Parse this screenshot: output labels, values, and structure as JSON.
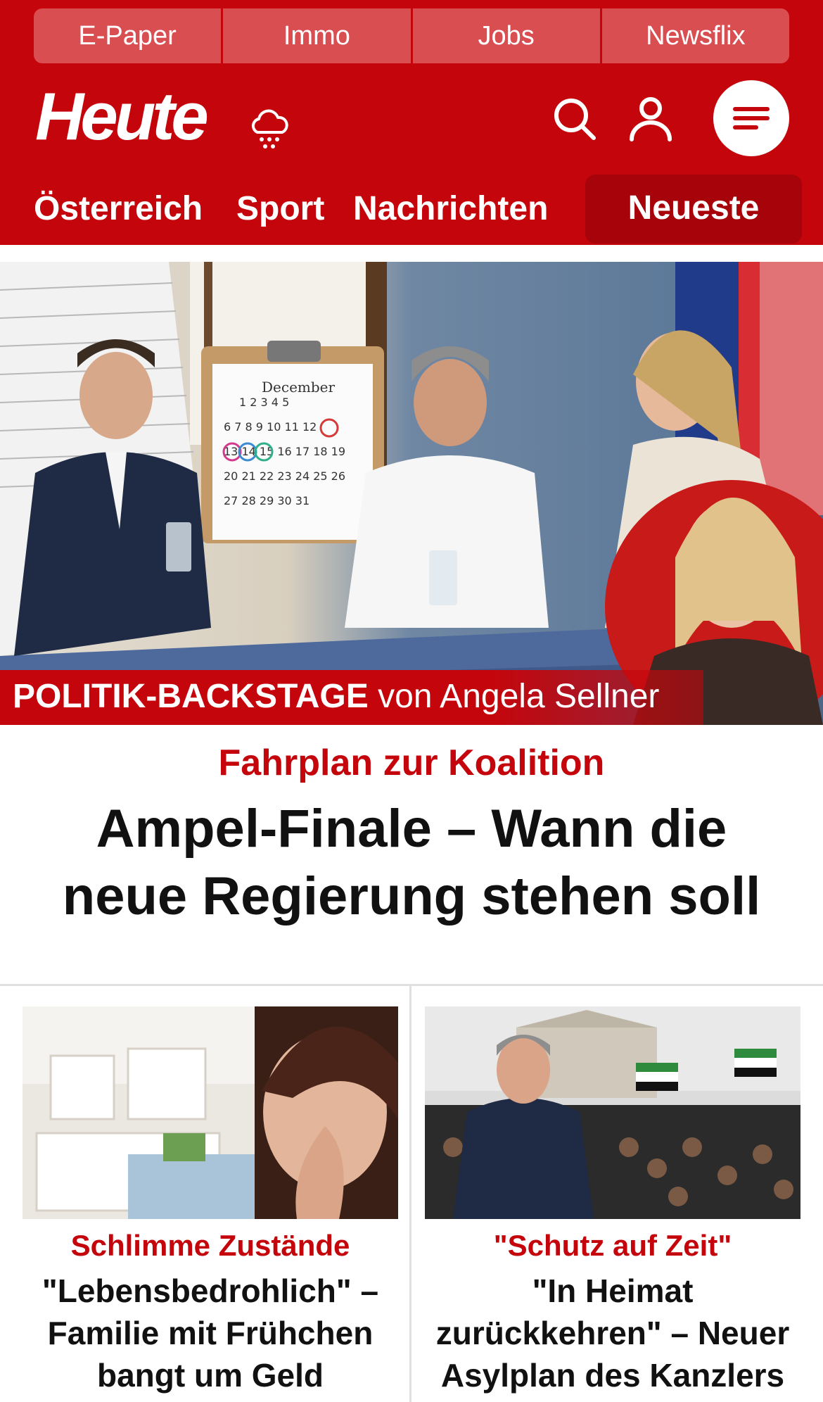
{
  "topnav": [
    "E-Paper",
    "Immo",
    "Jobs",
    "Newsflix"
  ],
  "brand": {
    "logo": "Heute",
    "weather_icon": "cloud-rain-icon"
  },
  "icons": {
    "search": "search-icon",
    "account": "user-icon",
    "menu": "menu-icon"
  },
  "sections": [
    "Österreich",
    "Sport",
    "Nachrichten",
    "Neueste"
  ],
  "hero": {
    "image_caption_strong": "POLITIK-BACKSTAGE",
    "image_caption_rest": " von Angela Sellner",
    "calendar_month": "December",
    "kicker": "Fahrplan zur Koalition",
    "title": "Ampel-Finale – Wann die neue Regierung stehen soll"
  },
  "cards": [
    {
      "kicker": "Schlimme Zustände",
      "title": "\"Lebensbedrohlich\" – Familie mit Frühchen bangt um Geld"
    },
    {
      "kicker": "\"Schutz auf Zeit\"",
      "title": "\"In Heimat zurückkehren\" – Neuer Asylplan des Kanzlers"
    }
  ],
  "colors": {
    "brand_red": "#c4060c",
    "tab_red": "#d94e51",
    "active_red": "#a6040a"
  }
}
